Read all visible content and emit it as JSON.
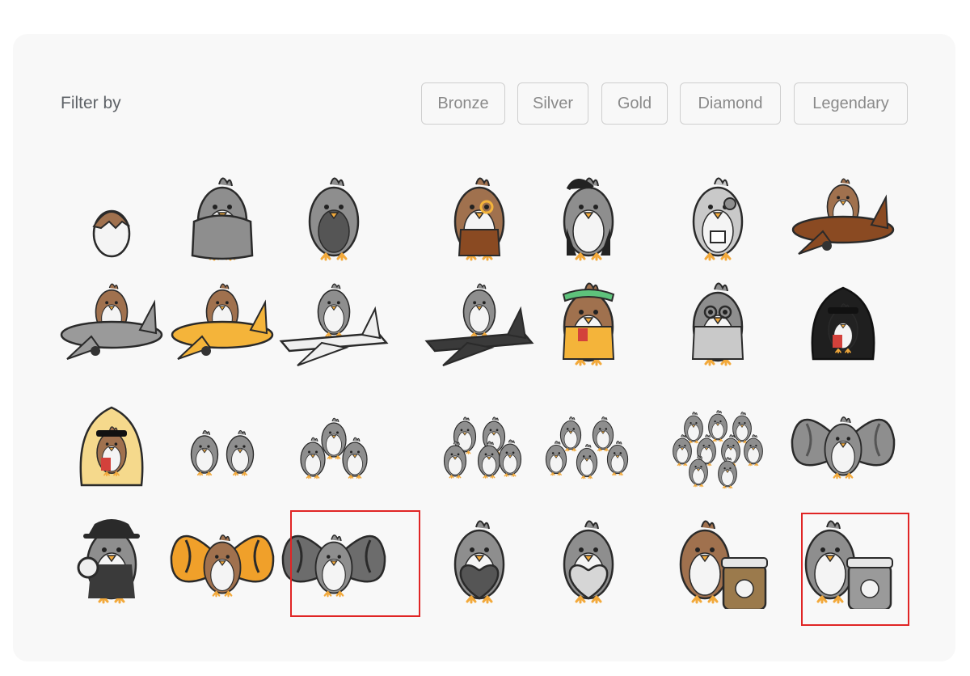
{
  "filter": {
    "label": "Filter by",
    "options": [
      "Bronze",
      "Silver",
      "Gold",
      "Diamond",
      "Legendary"
    ]
  },
  "grid": {
    "rows": [
      [
        "egg-bird-icon",
        "blanket-bird-icon",
        "plaid-shirt-bird-icon",
        "monocle-bird-icon",
        "leather-jacket-bird-icon",
        "robot-bird-icon",
        "brown-plane-pilot-bird-icon"
      ],
      [
        "gray-plane-pilot-bird-icon",
        "yellow-plane-pilot-bird-icon",
        "white-jet-pilot-bird-icon",
        "dark-jet-pilot-bird-icon",
        "visor-card-bird-icon",
        "glasses-card-bird-icon",
        "hoodie-card-bird-icon"
      ],
      [
        "yellow-hoodie-bird-icon",
        "two-birds-icon",
        "three-birds-icon",
        "four-birds-icon",
        "five-birds-icon",
        "bird-flock-icon",
        "flying-bird-icon"
      ],
      [
        "detective-bird-icon",
        "monarch-butterfly-bird-icon",
        "gray-butterfly-bird-icon",
        "dark-heart-bird-icon",
        "light-heart-bird-icon",
        "brown-jar-bird-icon",
        "gray-jar-bird-icon"
      ]
    ],
    "selected": [
      "gray-butterfly-bird-icon",
      "gray-jar-bird-icon"
    ]
  },
  "colors": {
    "selection": "#e02525",
    "brown": "#a0714e",
    "gray": "#8e8e8e",
    "yellow": "#f4b43a"
  }
}
